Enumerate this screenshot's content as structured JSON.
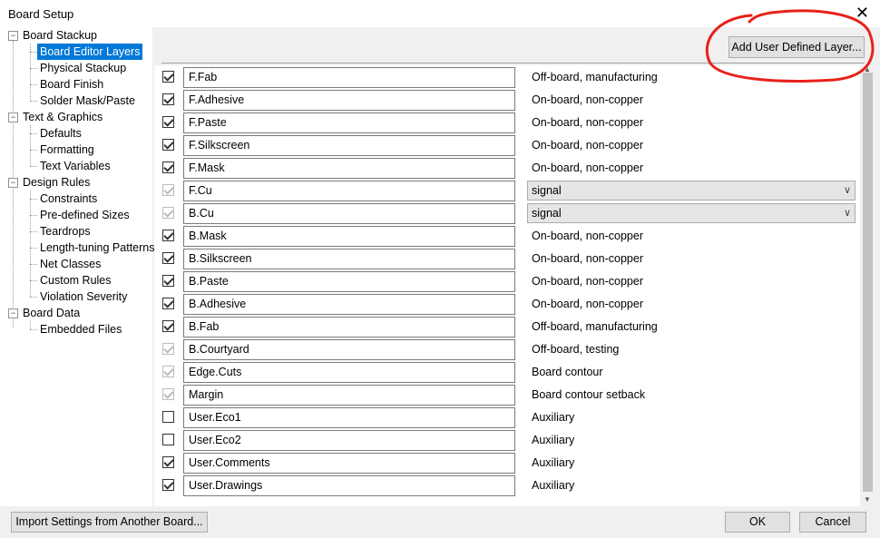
{
  "window": {
    "title": "Board Setup",
    "close_glyph": "✕"
  },
  "tree": {
    "board_stackup": "Board Stackup",
    "board_editor_layers": "Board Editor Layers",
    "physical_stackup": "Physical Stackup",
    "board_finish": "Board Finish",
    "solder_mask_paste": "Solder Mask/Paste",
    "text_graphics": "Text & Graphics",
    "defaults": "Defaults",
    "formatting": "Formatting",
    "text_variables": "Text Variables",
    "design_rules": "Design Rules",
    "constraints": "Constraints",
    "predefined_sizes": "Pre-defined Sizes",
    "teardrops": "Teardrops",
    "length_tuning": "Length-tuning Patterns",
    "net_classes": "Net Classes",
    "custom_rules": "Custom Rules",
    "violation_severity": "Violation Severity",
    "board_data": "Board Data",
    "embedded_files": "Embedded Files",
    "expander_glyph": "−"
  },
  "toolbar": {
    "add_layer_label": "Add User Defined Layer..."
  },
  "layers": [
    {
      "name": "F.Fab",
      "checked": true,
      "disabled": false,
      "type": "Off-board, manufacturing",
      "dropdown": false
    },
    {
      "name": "F.Adhesive",
      "checked": true,
      "disabled": false,
      "type": "On-board, non-copper",
      "dropdown": false
    },
    {
      "name": "F.Paste",
      "checked": true,
      "disabled": false,
      "type": "On-board, non-copper",
      "dropdown": false
    },
    {
      "name": "F.Silkscreen",
      "checked": true,
      "disabled": false,
      "type": "On-board, non-copper",
      "dropdown": false
    },
    {
      "name": "F.Mask",
      "checked": true,
      "disabled": false,
      "type": "On-board, non-copper",
      "dropdown": false
    },
    {
      "name": "F.Cu",
      "checked": true,
      "disabled": true,
      "type": "signal",
      "dropdown": true
    },
    {
      "name": "B.Cu",
      "checked": true,
      "disabled": true,
      "type": "signal",
      "dropdown": true
    },
    {
      "name": "B.Mask",
      "checked": true,
      "disabled": false,
      "type": "On-board, non-copper",
      "dropdown": false
    },
    {
      "name": "B.Silkscreen",
      "checked": true,
      "disabled": false,
      "type": "On-board, non-copper",
      "dropdown": false
    },
    {
      "name": "B.Paste",
      "checked": true,
      "disabled": false,
      "type": "On-board, non-copper",
      "dropdown": false
    },
    {
      "name": "B.Adhesive",
      "checked": true,
      "disabled": false,
      "type": "On-board, non-copper",
      "dropdown": false
    },
    {
      "name": "B.Fab",
      "checked": true,
      "disabled": false,
      "type": "Off-board, manufacturing",
      "dropdown": false
    },
    {
      "name": "B.Courtyard",
      "checked": true,
      "disabled": true,
      "type": "Off-board, testing",
      "dropdown": false
    },
    {
      "name": "Edge.Cuts",
      "checked": true,
      "disabled": true,
      "type": "Board contour",
      "dropdown": false
    },
    {
      "name": "Margin",
      "checked": true,
      "disabled": true,
      "type": "Board contour setback",
      "dropdown": false
    },
    {
      "name": "User.Eco1",
      "checked": false,
      "disabled": false,
      "type": "Auxiliary",
      "dropdown": false
    },
    {
      "name": "User.Eco2",
      "checked": false,
      "disabled": false,
      "type": "Auxiliary",
      "dropdown": false
    },
    {
      "name": "User.Comments",
      "checked": true,
      "disabled": false,
      "type": "Auxiliary",
      "dropdown": false
    },
    {
      "name": "User.Drawings",
      "checked": true,
      "disabled": false,
      "type": "Auxiliary",
      "dropdown": false
    }
  ],
  "footer": {
    "import_label": "Import Settings from Another Board...",
    "ok_label": "OK",
    "cancel_label": "Cancel"
  },
  "colors": {
    "selection": "#0078d7",
    "annotation_red": "#e8211b"
  },
  "icons": {
    "dropdown": "chevron-down-icon",
    "close": "close-icon"
  }
}
